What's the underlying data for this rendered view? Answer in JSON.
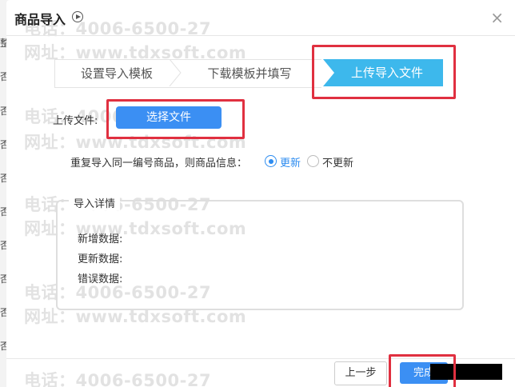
{
  "background": {
    "edge_chars": [
      "整",
      "否",
      "否",
      "否",
      "否",
      "否",
      "否",
      "否",
      "否",
      "否"
    ]
  },
  "dialog": {
    "title": "商品导入",
    "close": "×"
  },
  "watermark": {
    "phone": "电话：4006-6500-27",
    "site": "网址：www.tdxsoft.com"
  },
  "steps": [
    {
      "label": "设置导入模板",
      "active": false
    },
    {
      "label": "下载模板并填写",
      "active": false
    },
    {
      "label": "上传导入文件",
      "active": true
    }
  ],
  "upload": {
    "label": "上传文件:",
    "button": "选择文件"
  },
  "duplicate": {
    "prompt": "重复导入同一编号商品，则商品信息：",
    "options": [
      {
        "label": "更新",
        "selected": true
      },
      {
        "label": "不更新",
        "selected": false
      }
    ]
  },
  "details": {
    "title": "导入详情",
    "rows": [
      "新增数据:",
      "更新数据:",
      "错误数据:"
    ]
  },
  "footer": {
    "prev": "上一步",
    "done": "完成"
  },
  "colors": {
    "accent": "#3b8ff3",
    "step_active": "#3db8ec",
    "highlight": "#e03040"
  }
}
